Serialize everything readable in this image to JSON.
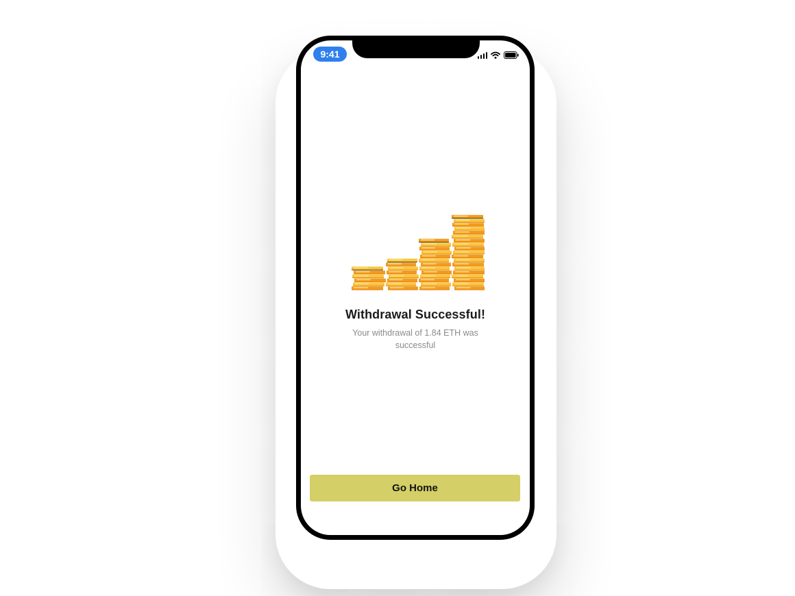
{
  "status_bar": {
    "time": "9:41",
    "icons": [
      "signal-icon",
      "wifi-icon",
      "battery-icon"
    ]
  },
  "illustration": {
    "icon": "coin-stacks-illustration",
    "stack_count": 4,
    "colors": {
      "coin_light": "#f9c63a",
      "coin_dark": "#f39a1e",
      "coin_edge": "#e07f12"
    }
  },
  "message": {
    "title": "Withdrawal Successful!",
    "subtitle": "Your withdrawal of 1.84 ETH was successful"
  },
  "actions": {
    "primary_label": "Go Home"
  },
  "colors": {
    "accent_button": "#d4cf66",
    "time_pill": "#2f80ed",
    "frame": "#000000"
  }
}
